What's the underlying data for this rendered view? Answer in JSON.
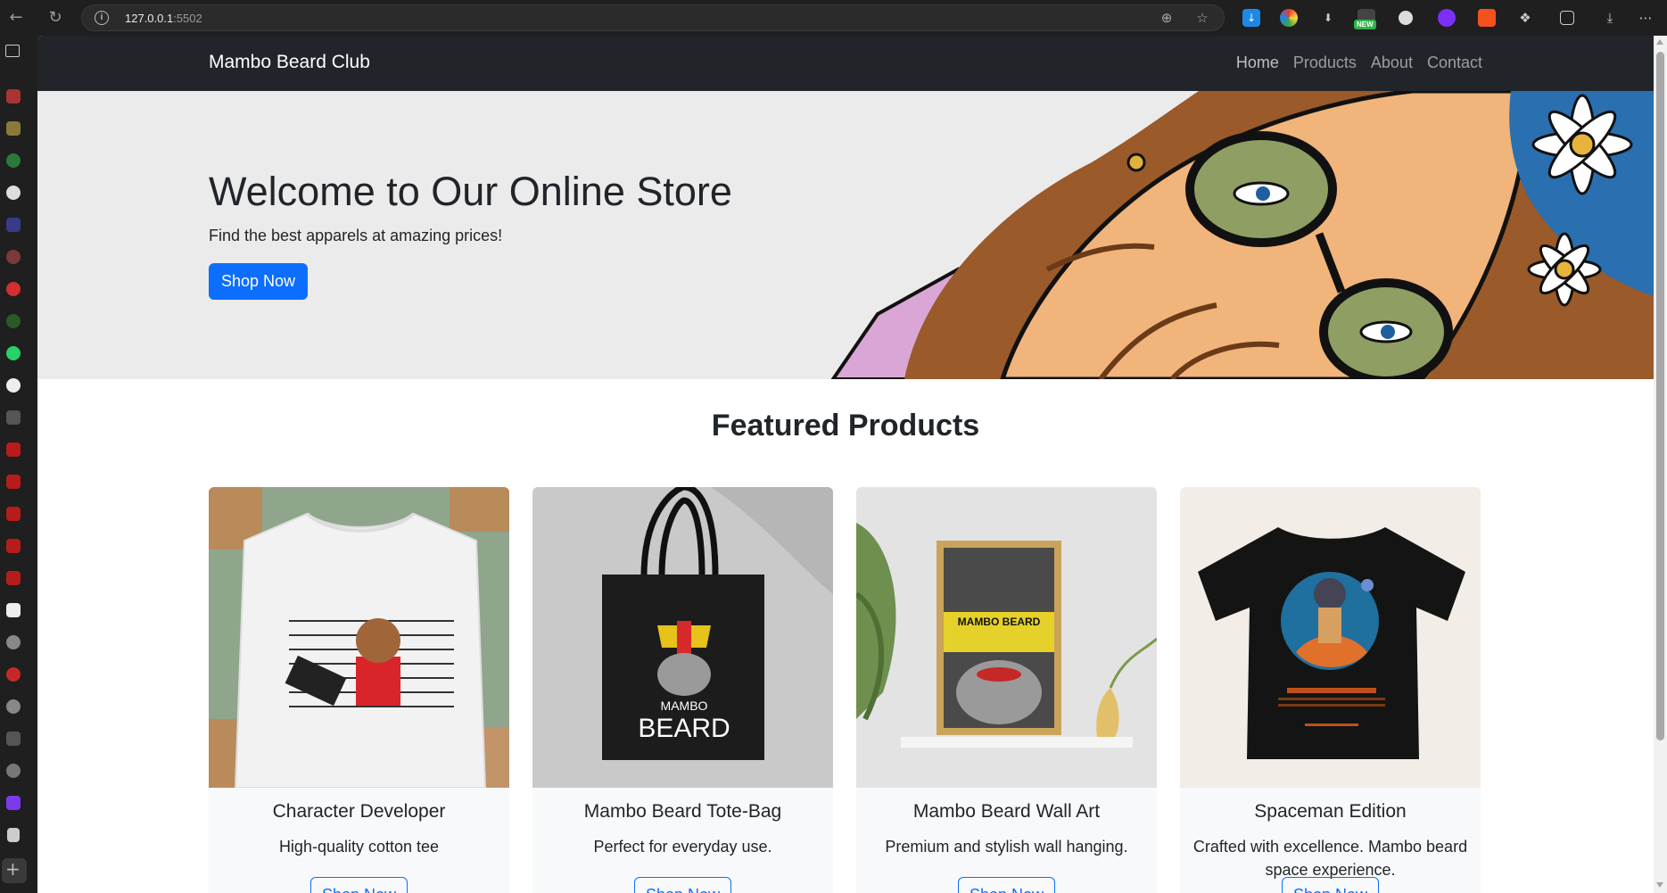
{
  "browser": {
    "url_host": "127.0.0.1",
    "url_port": ":5502"
  },
  "site": {
    "brand": "Mambo Beard Club",
    "nav": [
      "Home",
      "Products",
      "About",
      "Contact"
    ]
  },
  "hero": {
    "title": "Welcome to Our Online Store",
    "subtitle": "Find the best apparels at amazing prices!",
    "cta": "Shop Now"
  },
  "featured": {
    "heading": "Featured Products",
    "products": [
      {
        "title": "Character Developer",
        "description": "High-quality cotton tee",
        "button": "Shop Now"
      },
      {
        "title": "Mambo Beard Tote-Bag",
        "description": "Perfect for everyday use.",
        "button": "Shop Now"
      },
      {
        "title": "Mambo Beard Wall Art",
        "description": "Premium and stylish wall hanging.",
        "button": "Shop Now"
      },
      {
        "title": "Spaceman Edition",
        "description": "Crafted with excellence. Mambo beard space experience.",
        "button": "Shop Now"
      }
    ],
    "artwork_text": {
      "tote_small": "MAMBO",
      "tote_large": "BEARD",
      "wallart_banner": "MAMBO BEARD"
    }
  },
  "ext_new_badge": "NEW",
  "colors": {
    "navbar": "#212529",
    "primary": "#0d6efd",
    "hero_bg": "#ebebeb",
    "card_bg": "#f8f9fa"
  }
}
